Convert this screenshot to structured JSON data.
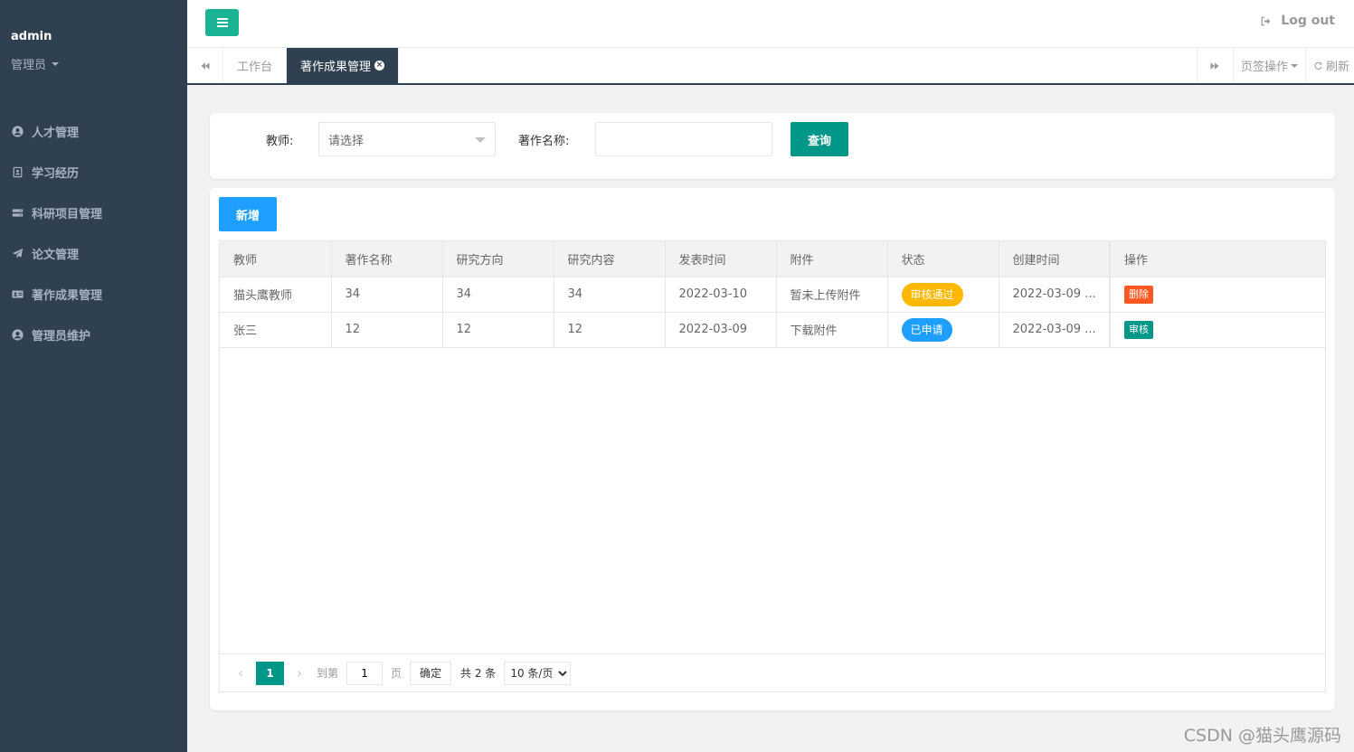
{
  "sidebar": {
    "user_name": "admin",
    "user_role": "管理员",
    "items": [
      {
        "label": "人才管理",
        "icon": "user-circle-icon"
      },
      {
        "label": "学习经历",
        "icon": "id-badge-icon"
      },
      {
        "label": "科研项目管理",
        "icon": "server-icon"
      },
      {
        "label": "论文管理",
        "icon": "paper-plane-icon"
      },
      {
        "label": "著作成果管理",
        "icon": "id-card-icon"
      },
      {
        "label": "管理员维护",
        "icon": "user-circle-icon"
      }
    ]
  },
  "header": {
    "logout_label": "Log out"
  },
  "tabs": {
    "items": [
      {
        "label": "工作台"
      },
      {
        "label": "著作成果管理"
      }
    ],
    "ops_label": "页签操作",
    "refresh_label": "刷新"
  },
  "search": {
    "teacher_label": "教师:",
    "teacher_placeholder": "请选择",
    "name_label": "著作名称:",
    "name_value": "",
    "query_label": "查询"
  },
  "table": {
    "add_label": "新增",
    "columns": [
      "教师",
      "著作名称",
      "研究方向",
      "研究内容",
      "发表时间",
      "附件",
      "状态",
      "创建时间",
      "操作"
    ],
    "rows": [
      {
        "teacher": "猫头鹰教师",
        "name": "34",
        "direction": "34",
        "content": "34",
        "publish_time": "2022-03-10",
        "attachment": "暂未上传附件",
        "status": "审核通过",
        "created": "2022-03-09 ...",
        "action": "删除"
      },
      {
        "teacher": "张三",
        "name": "12",
        "direction": "12",
        "content": "12",
        "publish_time": "2022-03-09",
        "attachment": "下载附件",
        "status": "已申请",
        "created": "2022-03-09 ...",
        "action": "审核"
      }
    ]
  },
  "pager": {
    "current_page": "1",
    "goto_label": "到第",
    "goto_value": "1",
    "page_unit": "页",
    "confirm_label": "确定",
    "total_label": "共 2 条",
    "page_size": "10 条/页"
  },
  "watermark": "CSDN @猫头鹰源码",
  "colors": {
    "sidebar_bg": "#2f4050",
    "accent_green": "#1ab394",
    "primary_teal": "#009688",
    "primary_blue": "#1e9fff",
    "warn_yellow": "#ffb800",
    "danger_orange": "#ff5722"
  }
}
